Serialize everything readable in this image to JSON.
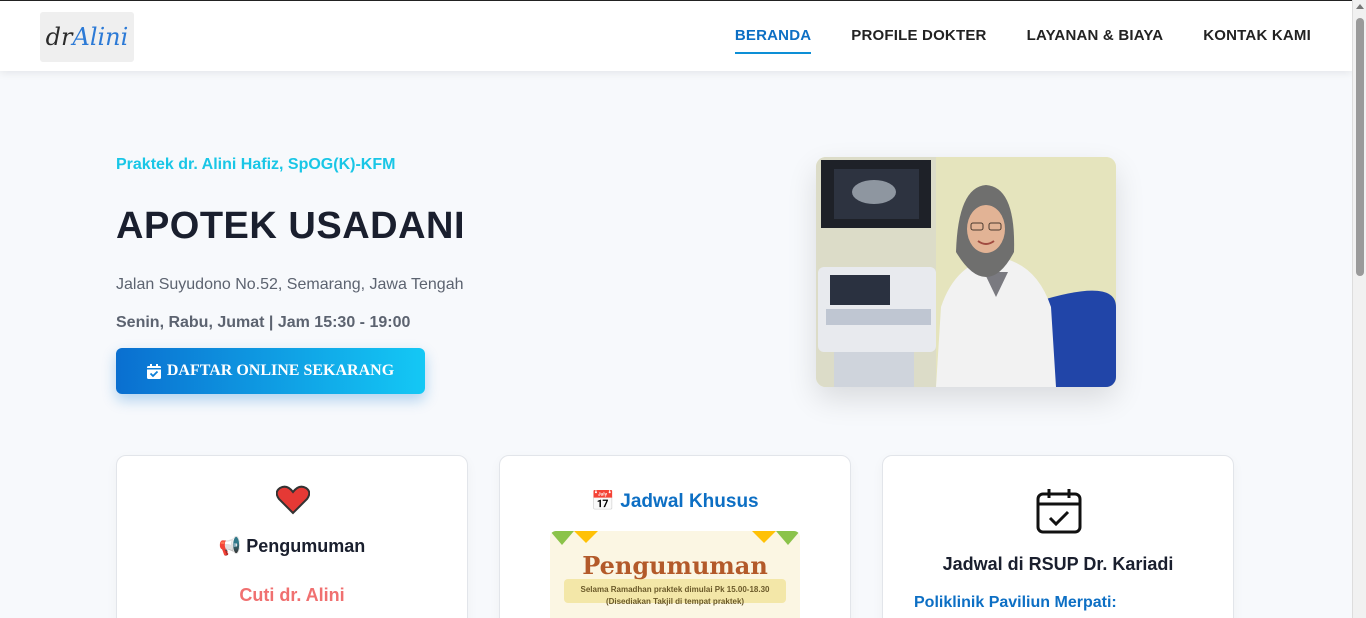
{
  "nav": {
    "logo_prefix": "dr",
    "logo_name": "Alini",
    "links": [
      {
        "label": "BERANDA",
        "active": true
      },
      {
        "label": "PROFILE DOKTER",
        "active": false
      },
      {
        "label": "LAYANAN & BIAYA",
        "active": false
      },
      {
        "label": "KONTAK KAMI",
        "active": false
      }
    ]
  },
  "hero": {
    "subtitle": "Praktek dr. Alini Hafiz, SpOG(K)-KFM",
    "title": "APOTEK USADANI",
    "address": "Jalan Suyudono No.52, Semarang, Jawa Tengah",
    "hours": "Senin, Rabu, Jumat | Jam 15:30 - 19:00",
    "cta_label": "DAFTAR ONLINE SEKARANG",
    "cta_icon": "calendar-check-icon"
  },
  "cards": [
    {
      "icon": "heart-icon",
      "title": "📢 Pengumuman",
      "subtitle": "Cuti dr. Alini"
    },
    {
      "title": "📅 Jadwal Khusus",
      "poster_title": "Pengumuman",
      "poster_line1": "Selama Ramadhan praktek dimulai Pk 15.00-18.30",
      "poster_line2": "(Disediakan Takjil di tempat praktek)"
    },
    {
      "icon": "calendar-check-icon",
      "title": "Jadwal di RSUP Dr. Kariadi",
      "subtitle": "Poliklinik Paviliun Merpati:"
    }
  ],
  "colors": {
    "accent": "#0d6fc4",
    "cyan": "#19c6e6",
    "alert": "#f07070"
  }
}
